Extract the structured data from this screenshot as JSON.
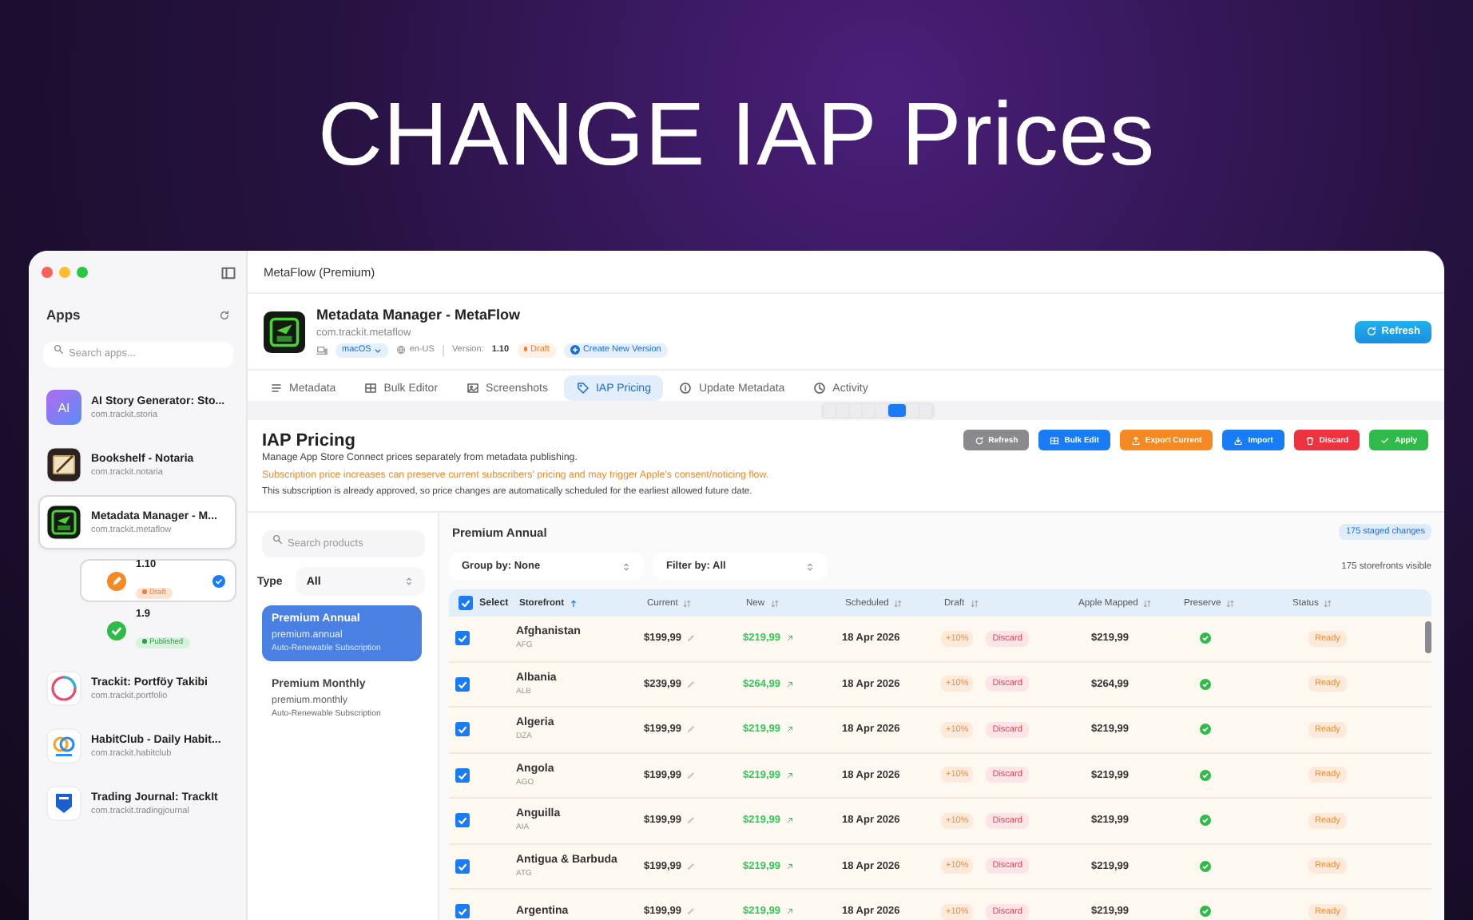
{
  "headline": "CHANGE IAP Prices",
  "window": {
    "title": "MetaFlow (Premium)"
  },
  "sidebar": {
    "title": "Apps",
    "search_placeholder": "Search apps...",
    "apps": [
      {
        "name": "AI Story Generator: Sto...",
        "bundle": "com.trackit.storia",
        "kind": "ai",
        "icon_text": "AI",
        "selected": false
      },
      {
        "name": "Bookshelf - Notaria",
        "bundle": "com.trackit.notaria",
        "kind": "book",
        "selected": false
      },
      {
        "name": "Metadata Manager - M...",
        "bundle": "com.trackit.metaflow",
        "kind": "frame",
        "selected": true,
        "versions": [
          {
            "version": "1.10",
            "status": "Draft",
            "kind": "draft",
            "selected": true
          },
          {
            "version": "1.9",
            "status": "Published",
            "kind": "published",
            "selected": false
          }
        ]
      },
      {
        "name": "Trackit: Portföy Takibi",
        "bundle": "com.trackit.portfolio",
        "kind": "ring",
        "selected": false
      },
      {
        "name": "HabitClub - Daily Habit...",
        "bundle": "com.trackit.habitclub",
        "kind": "rings",
        "selected": false
      },
      {
        "name": "Trading Journal: TrackIt",
        "bundle": "com.trackit.tradingjournal",
        "kind": "badge",
        "selected": false
      }
    ]
  },
  "app_header": {
    "name": "Metadata Manager - MetaFlow",
    "bundle": "com.trackit.metaflow",
    "platform": "macOS",
    "locale": "en-US",
    "version_label": "Version:",
    "version": "1.10",
    "status": "Draft",
    "create_button": "Create New Version",
    "refresh_button": "Refresh"
  },
  "tabs": [
    {
      "label": "Metadata",
      "kind": "list",
      "selected": false
    },
    {
      "label": "Bulk Editor",
      "kind": "grid",
      "selected": false
    },
    {
      "label": "Screenshots",
      "kind": "image",
      "selected": false
    },
    {
      "label": "IAP Pricing",
      "kind": "tag",
      "selected": true
    },
    {
      "label": "Update Metadata",
      "kind": "info",
      "selected": false
    },
    {
      "label": "Activity",
      "kind": "clock",
      "selected": false
    }
  ],
  "pricing": {
    "title": "IAP Pricing",
    "description": "Manage App Store Connect prices separately from metadata publishing.",
    "warning": "Subscription price increases can preserve current subscribers' pricing and may trigger Apple's consent/noticing flow.",
    "note": "This subscription is already approved, so price changes are automatically scheduled for the earliest allowed future date.",
    "actions": [
      {
        "label": "Refresh",
        "kind": "refresh",
        "color": "#8a8a8e"
      },
      {
        "label": "Bulk Edit",
        "kind": "grid",
        "color": "#1a7cf5"
      },
      {
        "label": "Export Current",
        "kind": "upload",
        "color": "#f58a25"
      },
      {
        "label": "Import",
        "kind": "download",
        "color": "#1a7cf5"
      },
      {
        "label": "Discard",
        "kind": "trash",
        "color": "#ee3340"
      },
      {
        "label": "Apply",
        "kind": "check",
        "color": "#2fba4a"
      }
    ]
  },
  "products": {
    "search_placeholder": "Search products",
    "type_label": "Type",
    "type_value": "All",
    "items": [
      {
        "name": "Premium Annual",
        "id": "premium.annual",
        "type": "Auto-Renewable Subscription",
        "selected": true
      },
      {
        "name": "Premium Monthly",
        "id": "premium.monthly",
        "type": "Auto-Renewable Subscription",
        "selected": false
      }
    ]
  },
  "panel": {
    "title": "Premium Annual",
    "staged": "175 staged changes",
    "group_by": "Group by: None",
    "filter_by": "Filter by: All",
    "visible": "175 storefronts visible"
  },
  "table": {
    "select_all": {
      "label": "Select",
      "checked": true
    },
    "columns": [
      {
        "label": "Storefront",
        "sorted": true
      },
      {
        "label": "Current",
        "sorted": false
      },
      {
        "label": "New",
        "sorted": false
      },
      {
        "label": "Scheduled",
        "sorted": false
      },
      {
        "label": "Draft",
        "sorted": false
      },
      {
        "label": "Apple Mapped",
        "sorted": false
      },
      {
        "label": "Preserve",
        "sorted": false
      },
      {
        "label": "Status",
        "sorted": false
      }
    ],
    "rows": [
      {
        "storefront": "Afghanistan",
        "code": "AFG",
        "current": "$199,99",
        "new": "$219,99",
        "scheduled": "18 Apr 2026",
        "draft": "+10%",
        "discard": "Discard",
        "apple_mapped": "$219,99",
        "preserve": true,
        "status": "Ready",
        "checked": true
      },
      {
        "storefront": "Albania",
        "code": "ALB",
        "current": "$239,99",
        "new": "$264,99",
        "scheduled": "18 Apr 2026",
        "draft": "+10%",
        "discard": "Discard",
        "apple_mapped": "$264,99",
        "preserve": true,
        "status": "Ready",
        "checked": true
      },
      {
        "storefront": "Algeria",
        "code": "DZA",
        "current": "$199,99",
        "new": "$219,99",
        "scheduled": "18 Apr 2026",
        "draft": "+10%",
        "discard": "Discard",
        "apple_mapped": "$219,99",
        "preserve": true,
        "status": "Ready",
        "checked": true
      },
      {
        "storefront": "Angola",
        "code": "AGO",
        "current": "$199,99",
        "new": "$219,99",
        "scheduled": "18 Apr 2026",
        "draft": "+10%",
        "discard": "Discard",
        "apple_mapped": "$219,99",
        "preserve": true,
        "status": "Ready",
        "checked": true
      },
      {
        "storefront": "Anguilla",
        "code": "AIA",
        "current": "$199,99",
        "new": "$219,99",
        "scheduled": "18 Apr 2026",
        "draft": "+10%",
        "discard": "Discard",
        "apple_mapped": "$219,99",
        "preserve": true,
        "status": "Ready",
        "checked": true
      },
      {
        "storefront": "Antigua & Barbuda",
        "code": "ATG",
        "current": "$199,99",
        "new": "$219,99",
        "scheduled": "18 Apr 2026",
        "draft": "+10%",
        "discard": "Discard",
        "apple_mapped": "$219,99",
        "preserve": true,
        "status": "Ready",
        "checked": true
      },
      {
        "storefront": "Argentina",
        "current": "$199,99",
        "new": "$219,99",
        "scheduled": "18 Apr 2026",
        "draft": "+10%",
        "discard": "Discard",
        "apple_mapped": "$219,99",
        "preserve": true,
        "status": "Ready",
        "checked": true
      }
    ]
  }
}
